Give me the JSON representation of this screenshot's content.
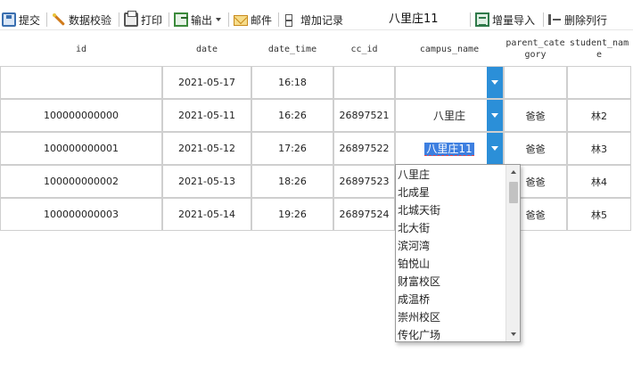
{
  "toolbar": {
    "submit": "提交",
    "validate": "数据校验",
    "print": "打印",
    "export": "输出",
    "mail": "邮件",
    "add_record": "增加记录",
    "title": "八里庄11",
    "incremental_import": "增量导入",
    "delete_column": "删除列行"
  },
  "columns": {
    "id": "id",
    "date": "date",
    "date_time": "date_time",
    "cc_id": "cc_id",
    "campus_name": "campus_name",
    "parent_category_l1": "parent_cate",
    "parent_category_l2": "gory",
    "student_name_l1": "student_nam",
    "student_name_l2": "e"
  },
  "rows": [
    {
      "id": "",
      "date": "2021-05-17",
      "date_time": "16:18",
      "cc_id": "",
      "campus_name": "",
      "parent_category": "",
      "student_name": ""
    },
    {
      "id": "100000000000",
      "date": "2021-05-11",
      "date_time": "16:26",
      "cc_id": "26897521",
      "campus_name": "八里庄",
      "parent_category": "爸爸",
      "student_name": "林2"
    },
    {
      "id": "100000000001",
      "date": "2021-05-12",
      "date_time": "17:26",
      "cc_id": "26897522",
      "campus_name": "八里庄11",
      "parent_category": "爸爸",
      "student_name": "林3"
    },
    {
      "id": "100000000002",
      "date": "2021-05-13",
      "date_time": "18:26",
      "cc_id": "26897523",
      "campus_name": "",
      "parent_category": "爸爸",
      "student_name": "林4"
    },
    {
      "id": "100000000003",
      "date": "2021-05-14",
      "date_time": "19:26",
      "cc_id": "26897524",
      "campus_name": "",
      "parent_category": "爸爸",
      "student_name": "林5"
    }
  ],
  "dropdown": {
    "options": [
      "八里庄",
      "北成星",
      "北城天街",
      "北大街",
      "滨河湾",
      "铂悦山",
      "财富校区",
      "成温桥",
      "崇州校区",
      "传化广场"
    ]
  },
  "colors": {
    "accent": "#2b8fd8",
    "selection": "#3d7fe0",
    "grid_border": "#cfcfcf"
  }
}
